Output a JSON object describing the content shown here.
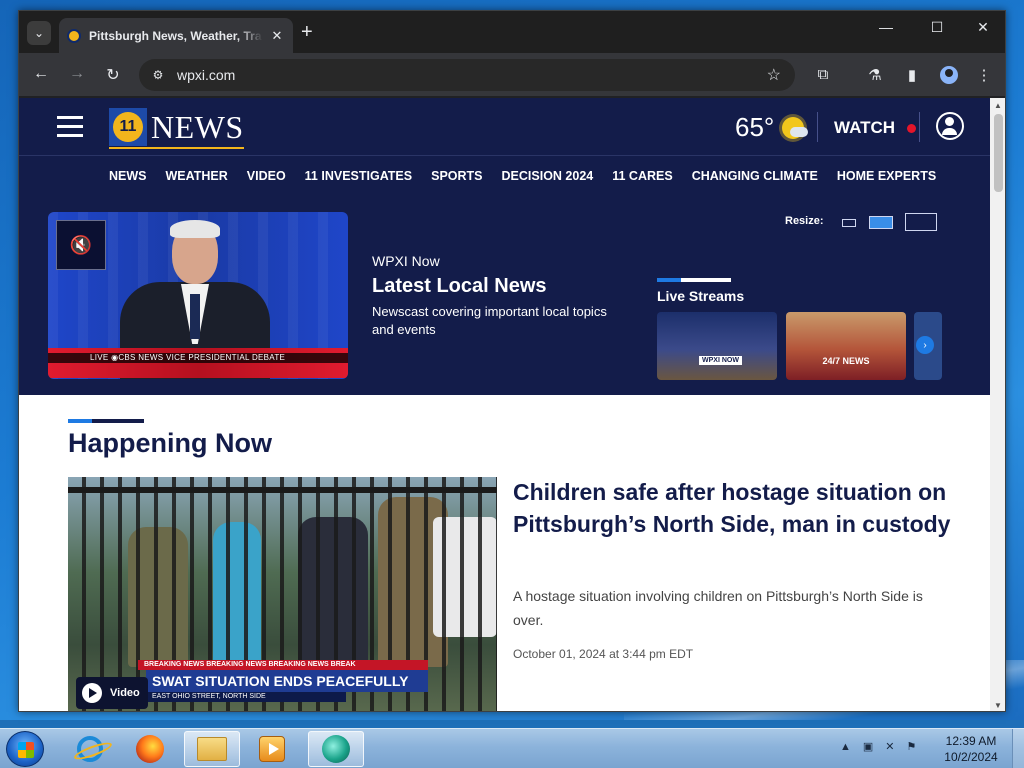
{
  "browser": {
    "tab_title": "Pittsburgh News, Weather, Tra",
    "url": "wpxi.com",
    "tab_menu_icon": "chevron-down-icon",
    "new_tab_icon": "plus-icon",
    "minimize": "—",
    "maximize": "☐",
    "close": "✕",
    "back": "←",
    "forward": "→",
    "reload": "↻",
    "bookmark": "☆",
    "menu": "⋮"
  },
  "site": {
    "logo_text": "NEWS",
    "logo_number": "11",
    "temperature": "65°",
    "weather_icon": "partly-sunny-icon",
    "watch_label": "WATCH",
    "nav": [
      "NEWS",
      "WEATHER",
      "VIDEO",
      "11 INVESTIGATES",
      "SPORTS",
      "DECISION 2024",
      "11 CARES",
      "CHANGING CLIMATE",
      "HOME EXPERTS"
    ]
  },
  "player": {
    "label": "WPXI Now",
    "title": "Latest Local News",
    "description": "Newscast covering important local topics and events",
    "chyron": "LIVE   ◉CBS NEWS   VICE PRESIDENTIAL DEBATE",
    "resize_label": "Resize:",
    "streams_title": "Live Streams",
    "stream_1_badge": "WPXI NOW",
    "stream_2_badge": "24/7 NEWS"
  },
  "happening": {
    "section_title": "Happening Now",
    "ticker": "BREAKING NEWS   BREAKING NEWS   BREAKING NEWS   BREAK",
    "video_headline": "SWAT SITUATION ENDS PEACEFULLY",
    "video_subline": "EAST OHIO STREET, NORTH SIDE",
    "video_label": "Video",
    "headline": "Children safe after hostage situation on Pittsburgh’s North Side, man in custody",
    "summary": "A hostage situation involving children on Pittsburgh’s North Side is over.",
    "date": "October 01, 2024 at 3:44 pm EDT"
  },
  "taskbar": {
    "time": "12:39 AM",
    "date": "10/2/2024",
    "tray_arrow": "▲"
  },
  "colors": {
    "brand_navy": "#131c4a",
    "brand_blue": "#1e7ae3",
    "brand_gold": "#f2b51c",
    "live_red": "#e4152a"
  }
}
